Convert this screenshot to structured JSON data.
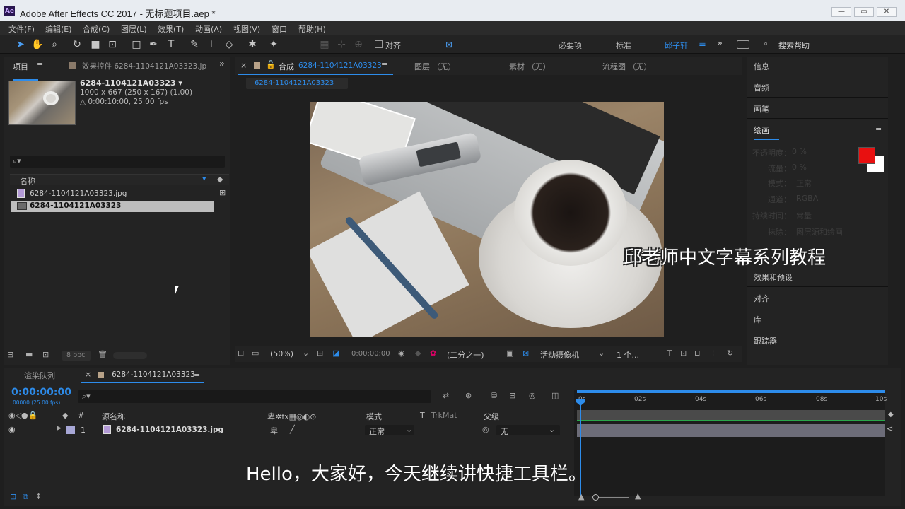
{
  "window": {
    "logo": "Ae",
    "title": "Adobe After Effects CC 2017 - 无标题项目.aep *",
    "min": "—",
    "max": "▭",
    "close": "✕"
  },
  "menu": [
    "文件(F)",
    "编辑(E)",
    "合成(C)",
    "图层(L)",
    "效果(T)",
    "动画(A)",
    "视图(V)",
    "窗口",
    "帮助(H)"
  ],
  "toolbar": {
    "snap_label": "对齐",
    "workspaces": [
      "必要项",
      "标准",
      "邱子轩"
    ],
    "search_placeholder": "搜索帮助",
    "more": "»"
  },
  "project": {
    "tab_project": "项目",
    "tab_effects": "效果控件 6284-1104121A03323.jp",
    "item_name": "6284-1104121A03323 ▾",
    "item_size": "1000 x 667  (250 x 167) (1.00)",
    "item_duration": "△ 0:00:10:00, 25.00 fps",
    "col_name": "名称",
    "files": [
      {
        "name": "6284-1104121A03323.jpg",
        "type": "footage"
      },
      {
        "name": "6284-1104121A03323",
        "type": "composition"
      }
    ],
    "bpc": "8 bpc"
  },
  "comp": {
    "tab_comp_prefix": "合成",
    "tab_comp_name": "6284-1104121A03323",
    "tab_layer": "图层  （无）",
    "tab_footage": "素材  （无）",
    "tab_flow": "流程图  （无）",
    "subtab": "6284-1104121A03323",
    "zoom": "(50%)",
    "time": "0:00:00:00",
    "resolution": "(二分之一)",
    "camera": "活动摄像机",
    "views": "1 个..."
  },
  "right_panel": {
    "items": [
      "信息",
      "音频",
      "画笔",
      "绘画"
    ],
    "paint_fields": [
      {
        "label": "不透明度：",
        "value": "0 %"
      },
      {
        "label": "流量：",
        "value": "0 %"
      },
      {
        "label": "模式：",
        "value": "正常"
      },
      {
        "label": "通道：",
        "value": "RGBA"
      },
      {
        "label": "持续时间：",
        "value": "常量"
      },
      {
        "label": "抹除：",
        "value": "图层源和绘画"
      }
    ],
    "lower_items": [
      "效果和预设",
      "对齐",
      "库",
      "跟踪器"
    ],
    "fg_color": "#e81010",
    "bg_color": "#ffffff"
  },
  "timeline": {
    "tab_render": "渲染队列",
    "tab_comp": "6284-1104121A03323",
    "timecode": "0:00:00:00",
    "timecode_sub": "00000 (25.00 fps)",
    "col_num": "#",
    "col_source": "源名称",
    "col_mode": "模式",
    "col_t": "T",
    "col_trkmat": "TrkMat",
    "col_parent": "父级",
    "ruler": [
      "0s",
      "02s",
      "04s",
      "06s",
      "08s",
      "10s"
    ],
    "layers": [
      {
        "num": "1",
        "name": "6284-1104121A03323.jpg",
        "mode": "正常",
        "parent": "无"
      }
    ]
  },
  "subtitles": {
    "watermark": "邱老师中文字幕系列教程",
    "caption": "Hello，大家好，今天继续讲快捷工具栏。"
  },
  "colors": {
    "accent": "#2d8ceb",
    "label_purple": "#a7a7d6"
  }
}
